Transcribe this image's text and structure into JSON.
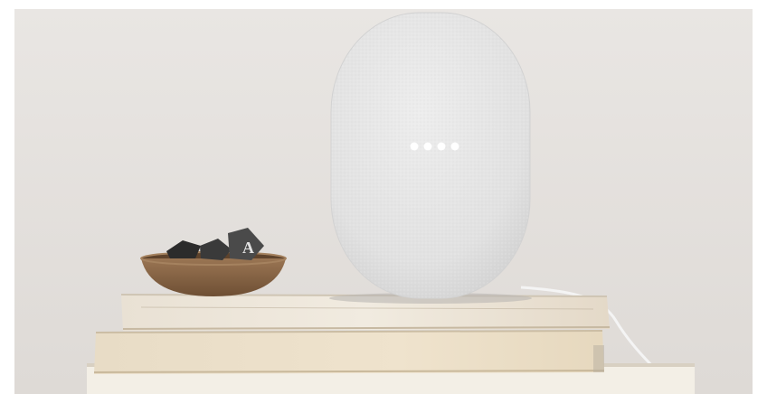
{
  "scene": {
    "description_icons": [
      "smart-speaker",
      "cork-bowl",
      "letter-block",
      "book-stack",
      "power-cable"
    ],
    "colors": {
      "wall": "#e4e1de",
      "speaker_fabric": "#e6e6e6",
      "speaker_light": "#ffffff",
      "bowl": "#8a6646",
      "books": "#ece3d2"
    },
    "speaker": {
      "indicator_light_count": 4
    },
    "letter_block": {
      "letter": "A"
    }
  }
}
